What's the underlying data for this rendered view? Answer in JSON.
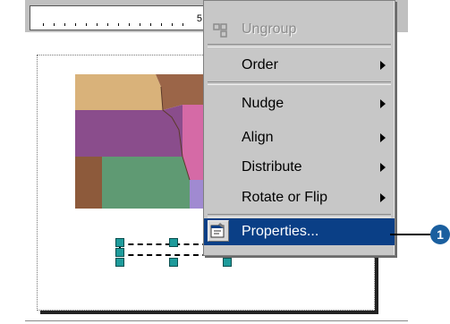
{
  "ruler": {
    "mark_label": "5"
  },
  "context_menu": {
    "items": [
      {
        "label": "Ungroup",
        "enabled": false,
        "icon": "ungroup-icon"
      },
      {
        "label": "Order",
        "has_submenu": true
      },
      {
        "label": "Nudge",
        "has_submenu": true
      },
      {
        "label": "Align",
        "has_submenu": true
      },
      {
        "label": "Distribute",
        "has_submenu": true
      },
      {
        "label": "Rotate or Flip",
        "has_submenu": true
      },
      {
        "label": "Properties...",
        "highlighted": true,
        "icon": "properties-icon"
      }
    ]
  },
  "callout": {
    "number": "1"
  },
  "colors": {
    "menu_bg": "#c7c7c7",
    "menu_highlight": "#0a3f86",
    "callout": "#1a5f9f",
    "handle": "#1e9b9b"
  }
}
